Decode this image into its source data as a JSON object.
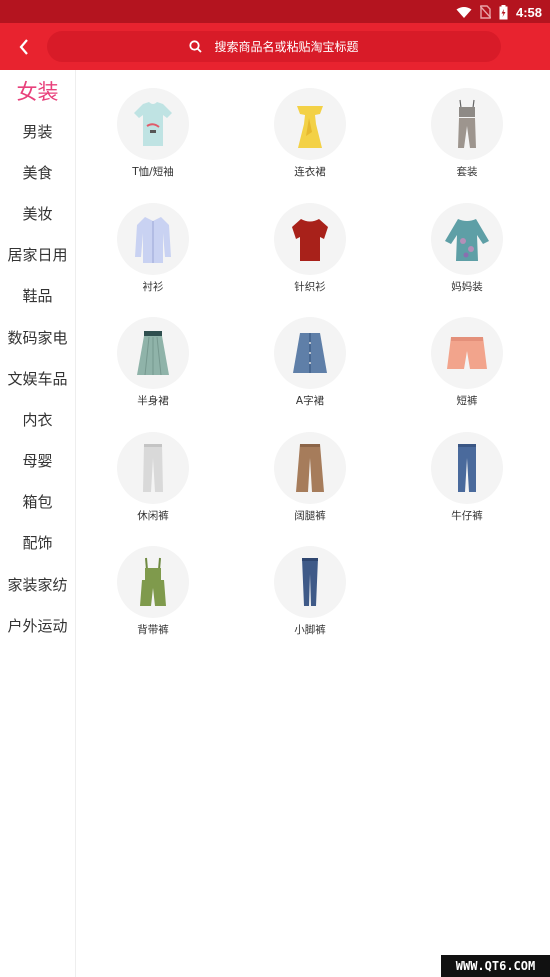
{
  "status_bar": {
    "time": "4:58",
    "icons": [
      "wifi-icon",
      "no-sim-icon",
      "battery-icon"
    ]
  },
  "header": {
    "back_icon": "chevron-left-icon",
    "search_placeholder": "搜索商品名或粘贴淘宝标题",
    "search_icon": "search-icon"
  },
  "sidebar": {
    "items": [
      {
        "label": "女装",
        "active": true
      },
      {
        "label": "男装"
      },
      {
        "label": "美食"
      },
      {
        "label": "美妆"
      },
      {
        "label": "居家日用"
      },
      {
        "label": "鞋品"
      },
      {
        "label": "数码家电"
      },
      {
        "label": "文娱车品"
      },
      {
        "label": "内衣"
      },
      {
        "label": "母婴"
      },
      {
        "label": "箱包"
      },
      {
        "label": "配饰"
      },
      {
        "label": "家装家纺"
      },
      {
        "label": "户外运动"
      }
    ]
  },
  "categories": [
    {
      "label": "T恤/短袖",
      "icon": "tshirt-icon"
    },
    {
      "label": "连衣裙",
      "icon": "dress-icon"
    },
    {
      "label": "套装",
      "icon": "outfit-set-icon"
    },
    {
      "label": "衬衫",
      "icon": "shirt-icon"
    },
    {
      "label": "针织衫",
      "icon": "knit-sweater-icon"
    },
    {
      "label": "妈妈装",
      "icon": "mom-blouse-icon"
    },
    {
      "label": "半身裙",
      "icon": "skirt-icon"
    },
    {
      "label": "A字裙",
      "icon": "a-line-skirt-icon"
    },
    {
      "label": "短裤",
      "icon": "shorts-icon"
    },
    {
      "label": "休闲裤",
      "icon": "casual-pants-icon"
    },
    {
      "label": "阔腿裤",
      "icon": "wide-leg-pants-icon"
    },
    {
      "label": "牛仔裤",
      "icon": "jeans-icon"
    },
    {
      "label": "背带裤",
      "icon": "overalls-icon"
    },
    {
      "label": "小脚裤",
      "icon": "skinny-pants-icon"
    }
  ],
  "colors": {
    "header_red": "#e8232f",
    "status_red": "#b4141f",
    "active_pink": "#e8407b"
  },
  "watermark": "WWW.QT6.COM"
}
